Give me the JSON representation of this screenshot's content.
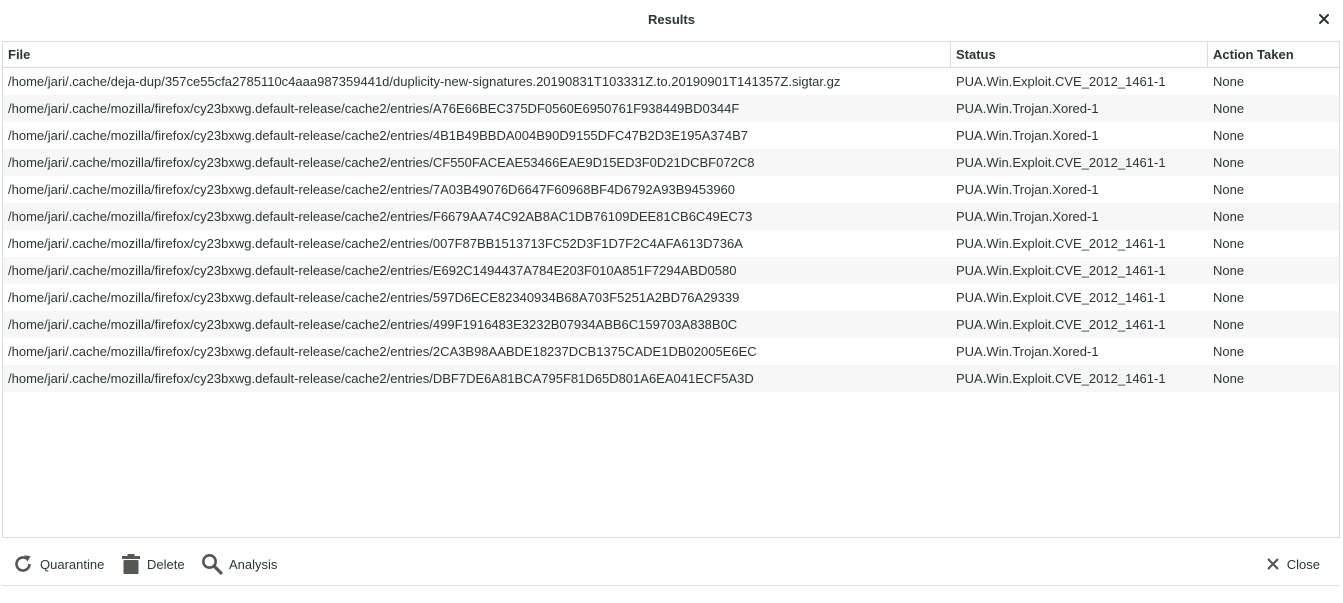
{
  "window": {
    "title": "Results"
  },
  "table": {
    "columns": {
      "file": "File",
      "status": "Status",
      "action": "Action Taken"
    },
    "rows": [
      {
        "file": "/home/jari/.cache/deja-dup/357ce55cfa2785110c4aaa987359441d/duplicity-new-signatures.20190831T103331Z.to.20190901T141357Z.sigtar.gz",
        "status": "PUA.Win.Exploit.CVE_2012_1461-1",
        "action": "None"
      },
      {
        "file": "/home/jari/.cache/mozilla/firefox/cy23bxwg.default-release/cache2/entries/A76E66BEC375DF0560E6950761F938449BD0344F",
        "status": "PUA.Win.Trojan.Xored-1",
        "action": "None"
      },
      {
        "file": "/home/jari/.cache/mozilla/firefox/cy23bxwg.default-release/cache2/entries/4B1B49BBDA004B90D9155DFC47B2D3E195A374B7",
        "status": "PUA.Win.Trojan.Xored-1",
        "action": "None"
      },
      {
        "file": "/home/jari/.cache/mozilla/firefox/cy23bxwg.default-release/cache2/entries/CF550FACEAE53466EAE9D15ED3F0D21DCBF072C8",
        "status": "PUA.Win.Exploit.CVE_2012_1461-1",
        "action": "None"
      },
      {
        "file": "/home/jari/.cache/mozilla/firefox/cy23bxwg.default-release/cache2/entries/7A03B49076D6647F60968BF4D6792A93B9453960",
        "status": "PUA.Win.Trojan.Xored-1",
        "action": "None"
      },
      {
        "file": "/home/jari/.cache/mozilla/firefox/cy23bxwg.default-release/cache2/entries/F6679AA74C92AB8AC1DB76109DEE81CB6C49EC73",
        "status": "PUA.Win.Trojan.Xored-1",
        "action": "None"
      },
      {
        "file": "/home/jari/.cache/mozilla/firefox/cy23bxwg.default-release/cache2/entries/007F87BB1513713FC52D3F1D7F2C4AFA613D736A",
        "status": "PUA.Win.Exploit.CVE_2012_1461-1",
        "action": "None"
      },
      {
        "file": "/home/jari/.cache/mozilla/firefox/cy23bxwg.default-release/cache2/entries/E692C1494437A784E203F010A851F7294ABD0580",
        "status": "PUA.Win.Exploit.CVE_2012_1461-1",
        "action": "None"
      },
      {
        "file": "/home/jari/.cache/mozilla/firefox/cy23bxwg.default-release/cache2/entries/597D6ECE82340934B68A703F5251A2BD76A29339",
        "status": "PUA.Win.Exploit.CVE_2012_1461-1",
        "action": "None"
      },
      {
        "file": "/home/jari/.cache/mozilla/firefox/cy23bxwg.default-release/cache2/entries/499F1916483E3232B07934ABB6C159703A838B0C",
        "status": "PUA.Win.Exploit.CVE_2012_1461-1",
        "action": "None"
      },
      {
        "file": "/home/jari/.cache/mozilla/firefox/cy23bxwg.default-release/cache2/entries/2CA3B98AABDE18237DCB1375CADE1DB02005E6EC",
        "status": "PUA.Win.Trojan.Xored-1",
        "action": "None"
      },
      {
        "file": "/home/jari/.cache/mozilla/firefox/cy23bxwg.default-release/cache2/entries/DBF7DE6A81BCA795F81D65D801A6EA041ECF5A3D",
        "status": "PUA.Win.Exploit.CVE_2012_1461-1",
        "action": "None"
      }
    ]
  },
  "toolbar": {
    "quarantine_label": "Quarantine",
    "quarantine_icon": "refresh-icon",
    "delete_label": "Delete",
    "delete_icon": "trash-icon",
    "analysis_label": "Analysis",
    "analysis_icon": "search-icon",
    "close_label": "Close",
    "close_icon": "close-icon"
  },
  "colors": {
    "text": "#2e3436",
    "icon": "#555753",
    "row_alt": "#f7f7f7",
    "border": "#dcdcdc"
  }
}
